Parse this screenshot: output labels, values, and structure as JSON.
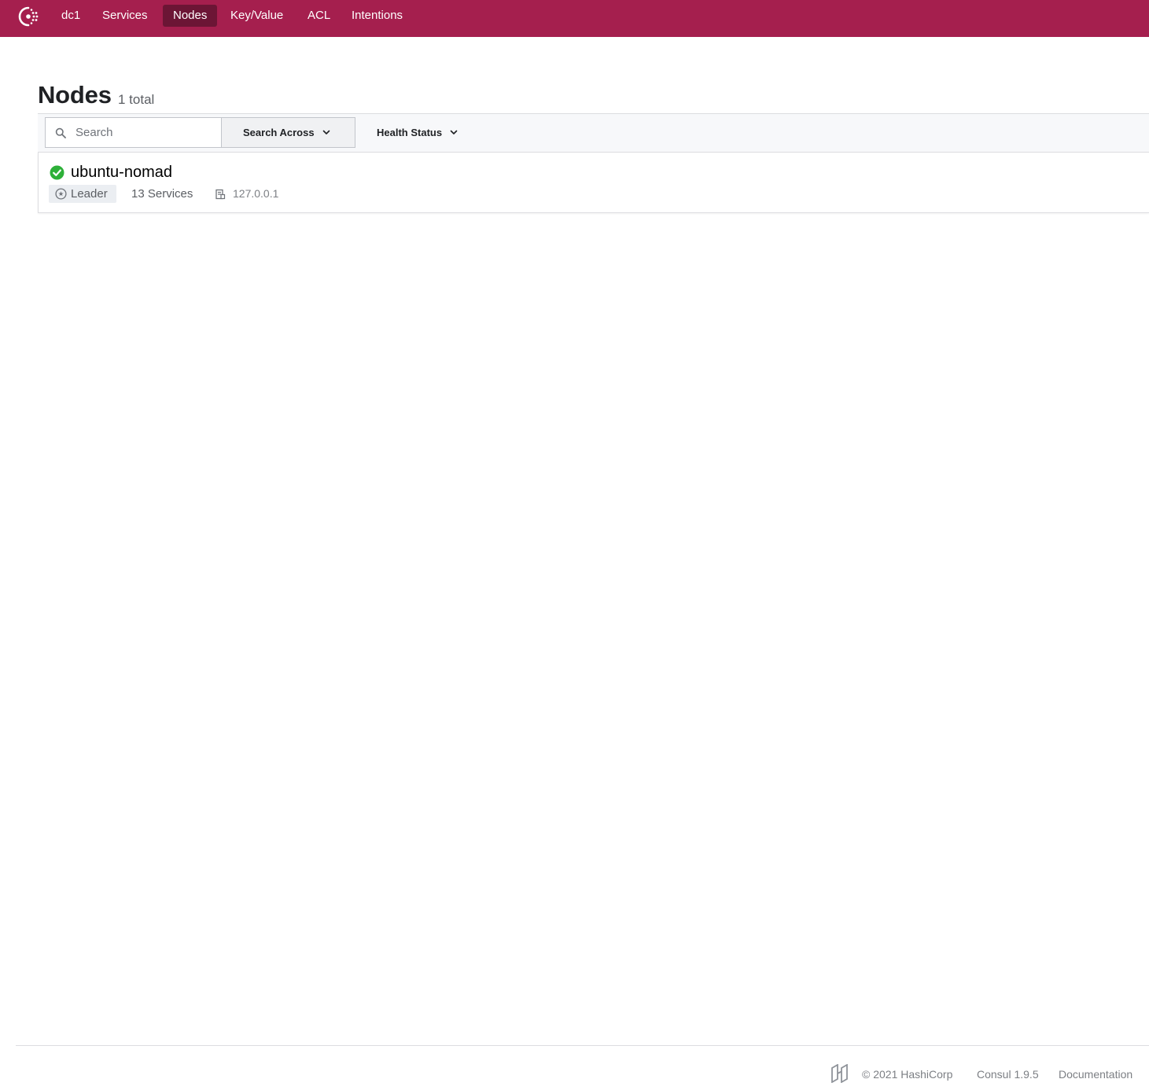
{
  "nav": {
    "logo_icon": "consul-logo-icon",
    "datacenter": "dc1",
    "items": [
      {
        "label": "Services",
        "active": false
      },
      {
        "label": "Nodes",
        "active": true
      },
      {
        "label": "Key/Value",
        "active": false
      },
      {
        "label": "ACL",
        "active": false
      },
      {
        "label": "Intentions",
        "active": false
      }
    ]
  },
  "page": {
    "title": "Nodes",
    "count": "1 total"
  },
  "filters": {
    "search_placeholder": "Search",
    "search_value": "",
    "search_across": "Search Across",
    "health_status": "Health Status"
  },
  "nodes": [
    {
      "name": "ubuntu-nomad",
      "health": "passing",
      "leader_label": "Leader",
      "services": "13 Services",
      "address": "127.0.0.1"
    }
  ],
  "footer": {
    "copyright": "© 2021 HashiCorp",
    "version": "Consul 1.9.5",
    "docs": "Documentation"
  },
  "colors": {
    "brand": "#a51f4e",
    "nav_active": "#6c1535",
    "health_passing": "#2eb039"
  }
}
